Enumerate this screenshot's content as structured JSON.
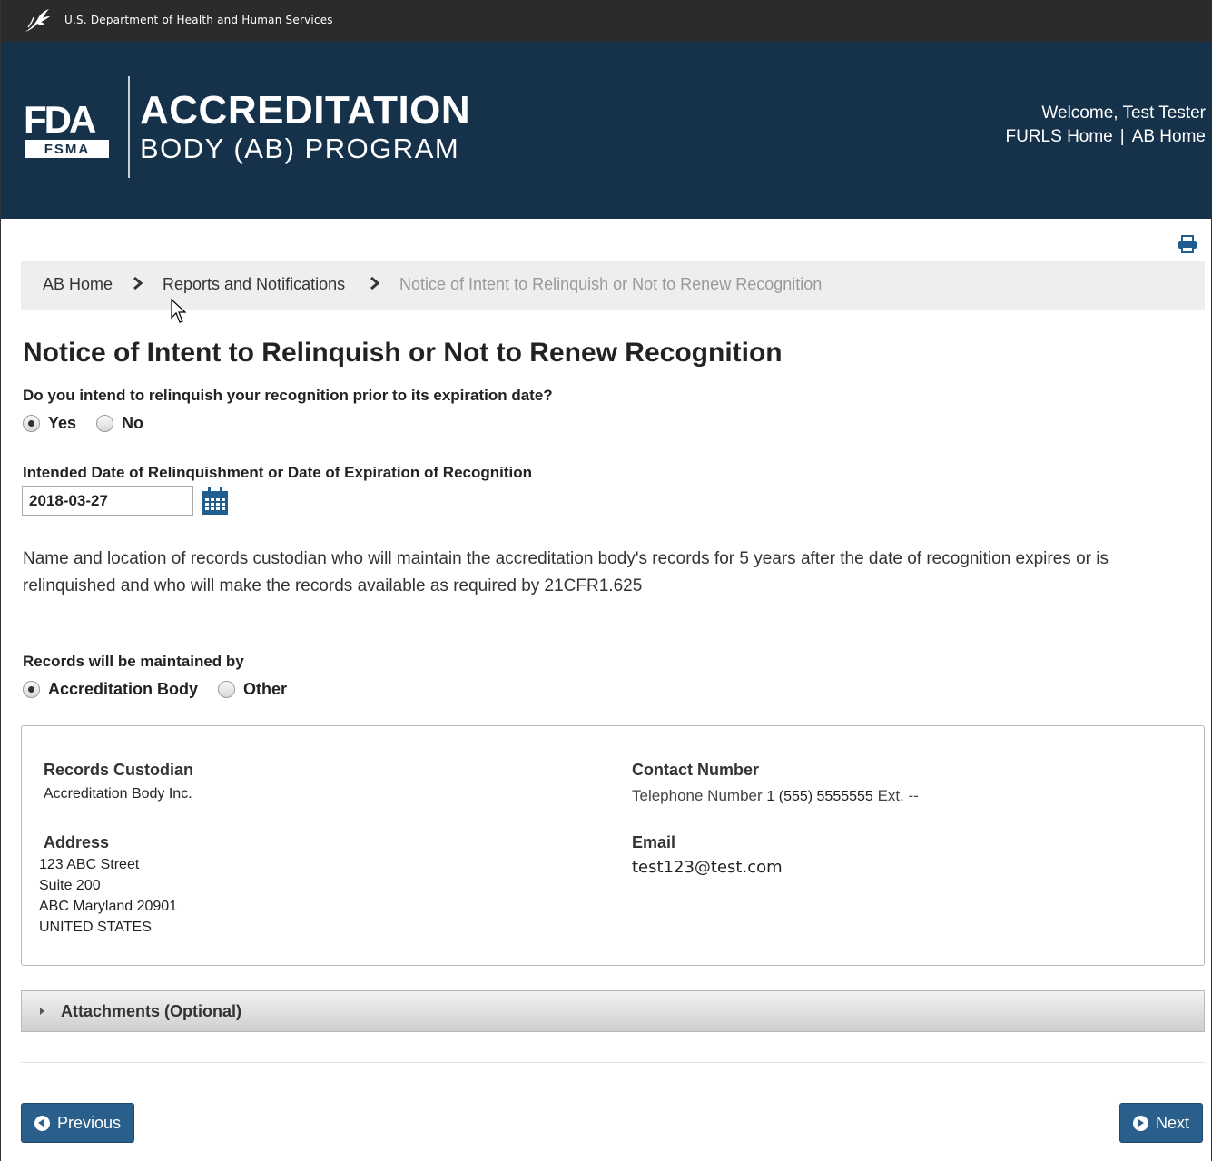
{
  "topbar": {
    "department": "U.S. Department of Health and Human Services"
  },
  "header": {
    "logo_fda": "FDA",
    "logo_fsma": "FSMA",
    "program_title": "ACCREDITATION",
    "program_subtitle": "BODY (AB) PROGRAM",
    "welcome": "Welcome, Test Tester",
    "links": [
      "FURLS Home",
      "AB Home"
    ],
    "link_separator": "|"
  },
  "breadcrumb": [
    "AB Home",
    "Reports and Notifications",
    "Notice of Intent to Relinquish or Not to Renew Recognition"
  ],
  "page_title": "Notice of Intent to Relinquish or Not to Renew Recognition",
  "q1": {
    "label": "Do you intend to relinquish your recognition prior to its expiration date?",
    "options": [
      "Yes",
      "No"
    ],
    "selected": "Yes"
  },
  "date_field": {
    "label": "Intended Date of Relinquishment or Date of Expiration of Recognition",
    "value": "2018-03-27"
  },
  "paragraph": "Name and location of records custodian who will maintain the accreditation body's records for 5 years after the date of recognition expires or is relinquished and who will make the records available as required by 21CFR1.625",
  "q2": {
    "label": "Records will be maintained by",
    "options": [
      "Accreditation Body",
      "Other"
    ],
    "selected": "Accreditation Body"
  },
  "custodian": {
    "custodian_label": "Records Custodian",
    "custodian_value": "Accreditation Body Inc.",
    "address_label": "Address",
    "address_lines": [
      "123 ABC Street",
      "Suite 200",
      "ABC Maryland 20901",
      "UNITED STATES"
    ],
    "contact_label": "Contact Number",
    "phone_prefix": "Telephone Number",
    "phone_number": "1 (555) 5555555",
    "phone_ext": "Ext. --",
    "email_label": "Email",
    "email_value": "test123@test.com"
  },
  "attachments": {
    "label": "Attachments (Optional)"
  },
  "buttons": {
    "previous": "Previous",
    "next": "Next"
  },
  "colors": {
    "header_bg": "#15324a",
    "topbar_bg": "#2b2b2b",
    "button_bg": "#2a5e8b",
    "accent": "#1f5e8e"
  }
}
